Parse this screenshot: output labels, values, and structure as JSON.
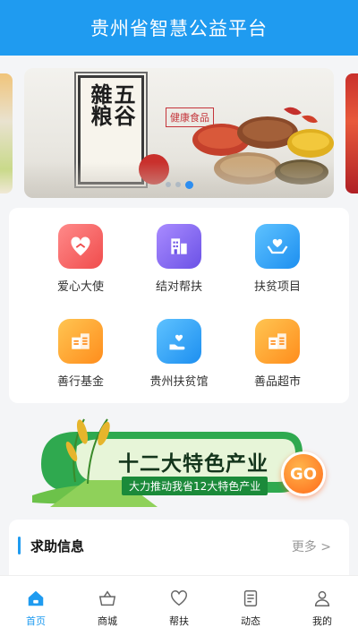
{
  "header": {
    "title": "贵州省智慧公益平台"
  },
  "banner": {
    "scroll_text_right": "五谷",
    "scroll_text_left": "雜粮",
    "tag": "健康食品",
    "dots": [
      false,
      false,
      true
    ]
  },
  "grid": [
    {
      "label": "爱心大使",
      "icon": "heart-hand-icon",
      "color": "#f04c4c"
    },
    {
      "label": "结对帮扶",
      "icon": "building-icon",
      "color": "#6b52e6"
    },
    {
      "label": "扶贫项目",
      "icon": "heart-hands-icon",
      "color": "#1d8ff0"
    },
    {
      "label": "善行基金",
      "icon": "building-icon",
      "color": "#ff8d1c"
    },
    {
      "label": "贵州扶贫馆",
      "icon": "hand-heart-icon",
      "color": "#1d8ff0"
    },
    {
      "label": "善品超市",
      "icon": "building-icon",
      "color": "#ff8d1c"
    }
  ],
  "promo": {
    "title": "十二大特色产业",
    "subtitle": "大力推动我省12大特色产业",
    "go": "GO"
  },
  "help": {
    "title": "求助信息",
    "more": "更多 >"
  },
  "tabbar": [
    {
      "label": "首页",
      "icon": "home-icon",
      "active": true
    },
    {
      "label": "商城",
      "icon": "basket-icon",
      "active": false
    },
    {
      "label": "帮扶",
      "icon": "heart-icon",
      "active": false
    },
    {
      "label": "动态",
      "icon": "document-icon",
      "active": false
    },
    {
      "label": "我的",
      "icon": "user-icon",
      "active": false
    }
  ]
}
